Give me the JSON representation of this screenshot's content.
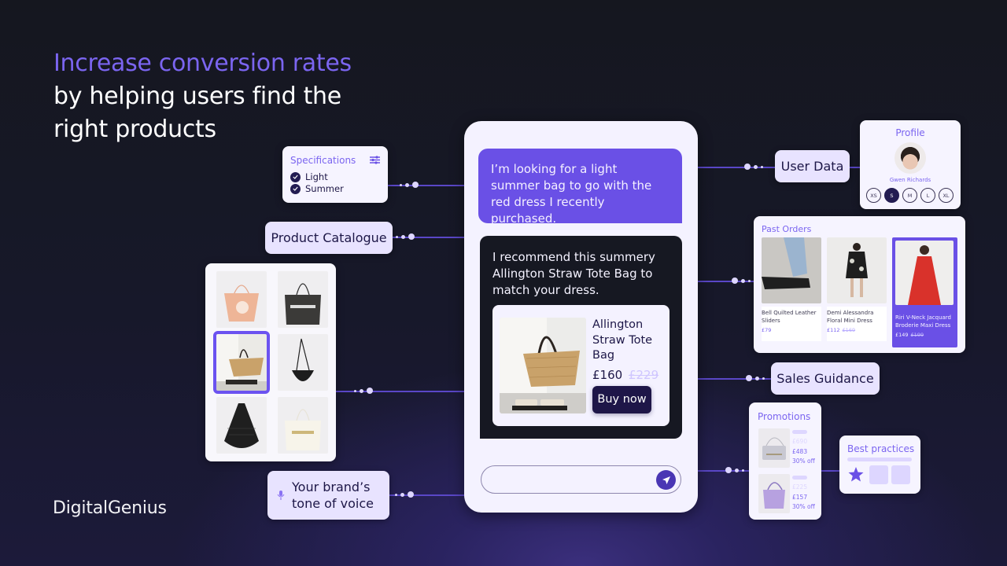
{
  "headline": {
    "accent": "Increase conversion rates",
    "line2": "by helping users find the",
    "line3": "right products"
  },
  "logo": {
    "part1": "Digital",
    "part2": "Genius"
  },
  "colors": {
    "accent": "#6a50e6",
    "dark_bg": "#15171f",
    "chip_bg": "#e8e3ff",
    "button_dark": "#1e1648"
  },
  "specifications": {
    "title": "Specifications",
    "icon": "sliders-icon",
    "items": [
      {
        "label": "Light",
        "checked": true
      },
      {
        "label": "Summer",
        "checked": true
      }
    ]
  },
  "chips": {
    "product_catalogue": "Product Catalogue",
    "user_data": "User Data",
    "sales_guidance": "Sales Guidance",
    "tone_of_voice_line1": "Your brand’s",
    "tone_of_voice_line2": "tone of voice",
    "tone_icon": "microphone-icon"
  },
  "catalogue": {
    "items": [
      {
        "name": "Pink tie-dye tote bag",
        "selected": false
      },
      {
        "name": "AllSaints black canvas tote",
        "selected": false
      },
      {
        "name": "Allington Straw Tote Bag",
        "selected": true
      },
      {
        "name": "Black half-moon crossbody bag",
        "selected": false
      },
      {
        "name": "Black woven hobo bag",
        "selected": false
      },
      {
        "name": "AllSaints cream canvas tote",
        "selected": false
      }
    ]
  },
  "chat": {
    "user_message": "I’m looking for a light summer bag to go with the red dress I recently purchased.",
    "bot_message": "I recommend this summery Allington Straw Tote Bag to match your dress.",
    "product": {
      "name": "Allington Straw Tote Bag",
      "price": "£160",
      "old_price": "£229",
      "buy_label": "Buy now"
    },
    "input_placeholder": "",
    "send_icon": "send-icon"
  },
  "profile": {
    "title": "Profile",
    "name": "Gwen Richards",
    "sizes": [
      "XS",
      "S",
      "M",
      "L",
      "XL"
    ],
    "selected_size": "S"
  },
  "past_orders": {
    "title": "Past Orders",
    "items": [
      {
        "name": "Bell Quilted Leather Sliders",
        "price": "£79",
        "old_price": "",
        "selected": false
      },
      {
        "name": "Demi Alessandra Floral Mini Dress",
        "price": "£112",
        "old_price": "£169",
        "selected": false
      },
      {
        "name": "Riri V-Neck Jacquard Broderie Maxi Dress",
        "price": "£149",
        "old_price": "£199",
        "selected": true
      }
    ]
  },
  "promotions": {
    "title": "Promotions",
    "items": [
      {
        "old_price": "£690",
        "price": "£483",
        "discount": "30% off"
      },
      {
        "old_price": "£225",
        "price": "£157",
        "discount": "30% off"
      }
    ]
  },
  "best_practices": {
    "title": "Best practices",
    "icon": "star-icon"
  }
}
